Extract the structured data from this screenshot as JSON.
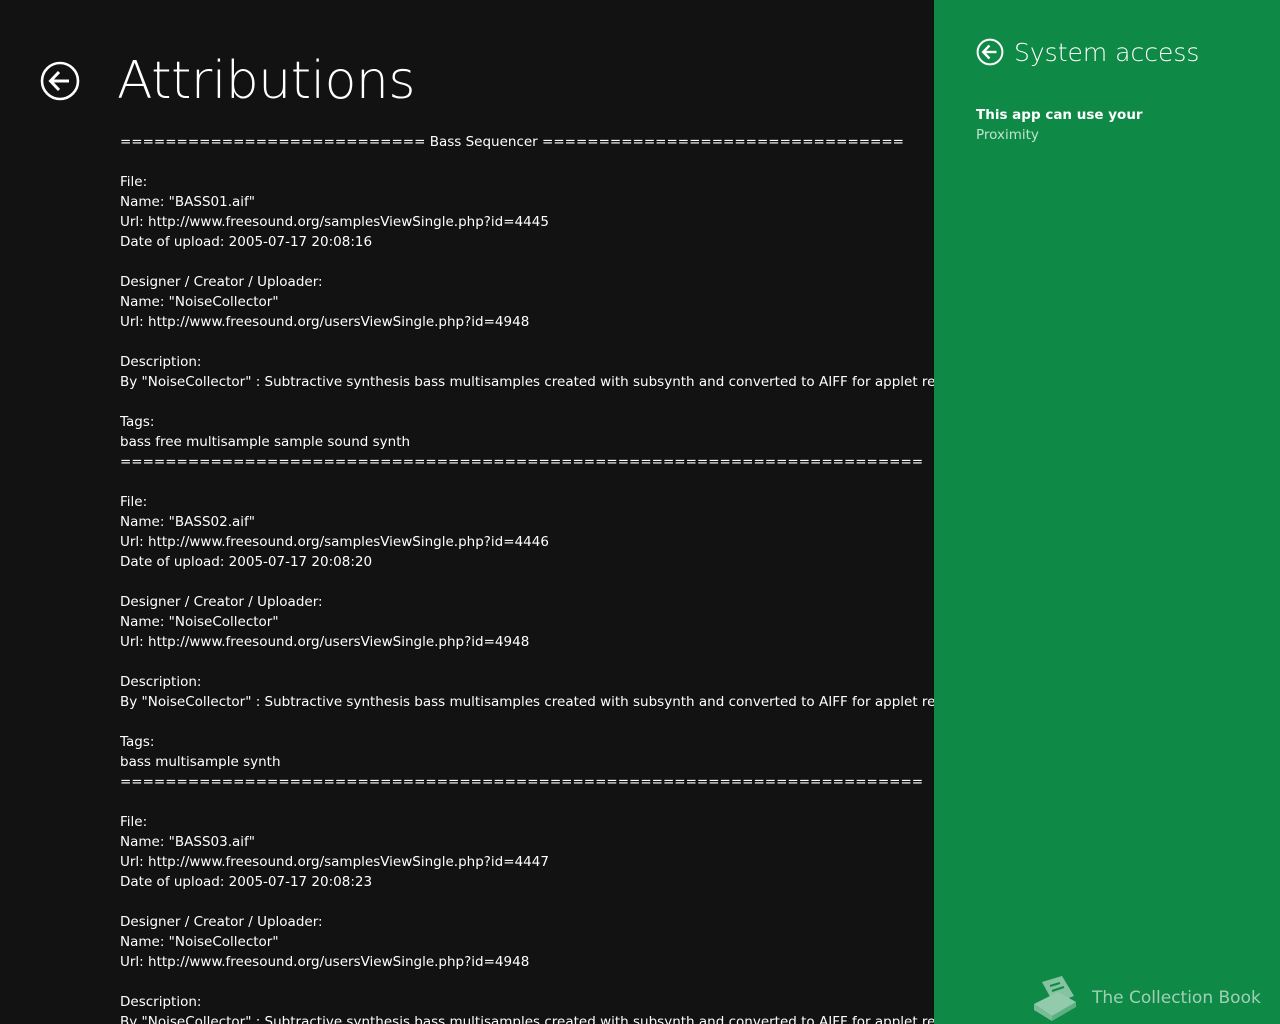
{
  "main": {
    "title": "Attributions",
    "attributions_text": "=========================== Bass Sequencer ================================\n\nFile:\nName: \"BASS01.aif\"\nUrl: http://www.freesound.org/samplesViewSingle.php?id=4445\nDate of upload: 2005-07-17 20:08:16\n\nDesigner / Creator / Uploader:\nName: \"NoiseCollector\"\nUrl: http://www.freesound.org/usersViewSingle.php?id=4948\n\nDescription:\nBy \"NoiseCollector\" : Subtractive synthesis bass multisamples created with subsynth and converted to AIFF for applet recognition.\n\nTags:\nbass free multisample sample sound synth\n=======================================================================\n\nFile:\nName: \"BASS02.aif\"\nUrl: http://www.freesound.org/samplesViewSingle.php?id=4446\nDate of upload: 2005-07-17 20:08:20\n\nDesigner / Creator / Uploader:\nName: \"NoiseCollector\"\nUrl: http://www.freesound.org/usersViewSingle.php?id=4948\n\nDescription:\nBy \"NoiseCollector\" : Subtractive synthesis bass multisamples created with subsynth and converted to AIFF for applet recognition.\n\nTags:\nbass multisample synth\n=======================================================================\n\nFile:\nName: \"BASS03.aif\"\nUrl: http://www.freesound.org/samplesViewSingle.php?id=4447\nDate of upload: 2005-07-17 20:08:23\n\nDesigner / Creator / Uploader:\nName: \"NoiseCollector\"\nUrl: http://www.freesound.org/usersViewSingle.php?id=4948\n\nDescription:\nBy \"NoiseCollector\" : Subtractive synthesis bass multisamples created with subsynth and converted to AIFF for applet recognition."
  },
  "settings_pane": {
    "title": "System access",
    "permission_heading": "This app can use your",
    "permissions": [
      "Proximity"
    ],
    "background_color": "#0f8a46"
  },
  "watermark": {
    "text": "The Collection Book",
    "icon": "book-icon"
  },
  "icons": {
    "back": "back-arrow-circle-icon"
  }
}
